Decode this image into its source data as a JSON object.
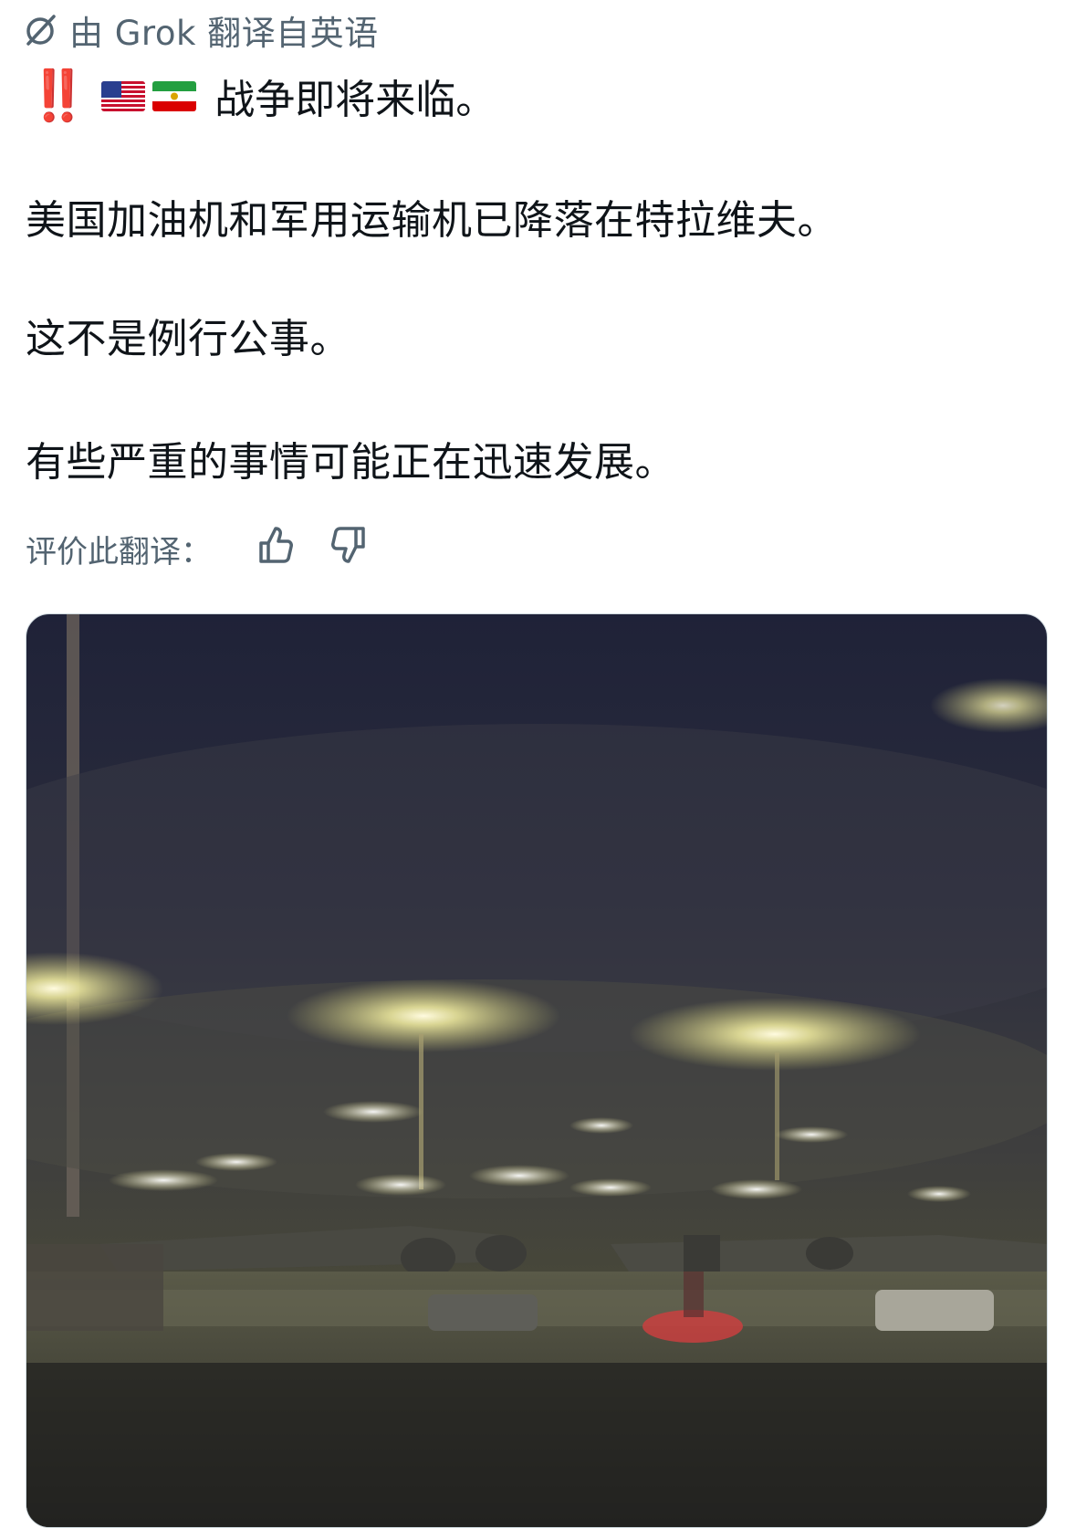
{
  "translation_notice": {
    "text": "由 Grok 翻译自英语"
  },
  "post": {
    "title_emoji": "‼️",
    "flags": [
      "us-flag",
      "iran-lion-and-sun-flag"
    ],
    "title": "战争即将来临。",
    "paragraphs": [
      "美国加油机和军用运输机已降落在特拉维夫。",
      "这不是例行公事。",
      "有些严重的事情可能正在迅速发展。"
    ]
  },
  "rating": {
    "label": "评价此翻译：",
    "up_icon": "thumbs-up-icon",
    "down_icon": "thumbs-down-icon"
  },
  "media": {
    "type": "video-still",
    "scene": "night airport apron with aircraft and floodlights"
  },
  "colors": {
    "text": "#0f1419",
    "muted": "#536471",
    "alert": "#e0162b"
  }
}
